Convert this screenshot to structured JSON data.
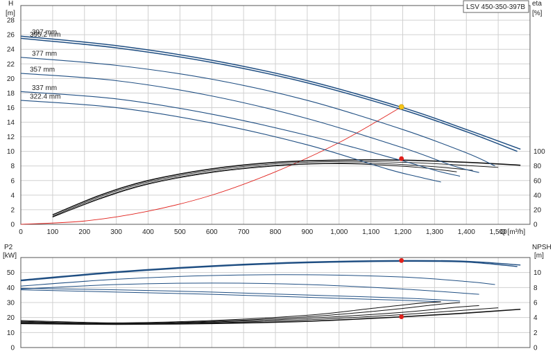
{
  "model_label": "LSV 450-350-397B",
  "colors": {
    "impeller": "#1f4e82",
    "efficiency": "#111111",
    "system": "#e0201b",
    "duty_point": "#e0201b",
    "duty_highlight": "#f5c518",
    "grid": "#d0d0d0",
    "axis": "#555555"
  },
  "chart_data": [
    {
      "type": "line",
      "panel": "head-efficiency",
      "y_axis_left": {
        "title": "H",
        "unit": "[m]",
        "range": [
          0,
          30
        ],
        "ticks": [
          0,
          2,
          4,
          6,
          8,
          10,
          12,
          14,
          16,
          18,
          20,
          22,
          24,
          26,
          28
        ]
      },
      "y_axis_right": {
        "title": "eta",
        "unit": "[%]",
        "range": [
          0,
          300
        ],
        "ticks": [
          0,
          20,
          40,
          60,
          80,
          100
        ]
      },
      "x_axis": {
        "title": "Q [m³/h]",
        "range": [
          0,
          1600
        ],
        "ticks": [
          0,
          100,
          200,
          300,
          400,
          500,
          600,
          700,
          800,
          900,
          1000,
          1100,
          1200,
          1300,
          1400,
          1500
        ],
        "tick_labels": [
          "0",
          "100",
          "200",
          "300",
          "400",
          "500",
          "600",
          "700",
          "800",
          "900",
          "1,000",
          "1,100",
          "1,200",
          "1,300",
          "1,400",
          "1,500"
        ]
      },
      "grid": true,
      "series": [
        {
          "name": "397 mm",
          "q": [
            0,
            300,
            600,
            900,
            1200,
            1400,
            1570
          ],
          "h": [
            25.8,
            24.5,
            22.5,
            19.7,
            16.0,
            13.0,
            10.3
          ]
        },
        {
          "name": "395.2 mm",
          "q": [
            0,
            300,
            600,
            900,
            1200,
            1400,
            1560
          ],
          "h": [
            25.5,
            24.2,
            22.2,
            19.4,
            15.7,
            12.7,
            10.0
          ]
        },
        {
          "name": "377 mm",
          "q": [
            0,
            300,
            600,
            900,
            1200,
            1400,
            1490
          ],
          "h": [
            22.9,
            21.8,
            19.9,
            17.0,
            13.0,
            9.8,
            8.0
          ]
        },
        {
          "name": "357 mm",
          "q": [
            0,
            300,
            600,
            900,
            1200,
            1360,
            1440
          ],
          "h": [
            20.7,
            19.7,
            17.6,
            14.5,
            10.5,
            8.0,
            7.1
          ]
        },
        {
          "name": "337 mm",
          "q": [
            0,
            300,
            600,
            900,
            1200,
            1310,
            1380
          ],
          "h": [
            18.2,
            17.2,
            15.1,
            12.2,
            8.7,
            7.3,
            6.6
          ]
        },
        {
          "name": "322.4 mm",
          "q": [
            0,
            300,
            600,
            900,
            1150,
            1240,
            1320
          ],
          "h": [
            17.0,
            16.0,
            13.9,
            10.9,
            7.6,
            6.6,
            5.8
          ]
        }
      ],
      "efficiency_series": [
        {
          "q": [
            100,
            250,
            400,
            600,
            800,
            1000,
            1200,
            1400,
            1570
          ],
          "eta": [
            13,
            40,
            60,
            76,
            85,
            88,
            88,
            85,
            81
          ]
        },
        {
          "q": [
            100,
            250,
            400,
            600,
            800,
            1000,
            1200,
            1350,
            1500
          ],
          "eta": [
            11,
            38,
            58,
            74,
            83,
            86,
            85,
            82,
            78
          ]
        },
        {
          "q": [
            100,
            250,
            400,
            600,
            800,
            1000,
            1150,
            1300,
            1420
          ],
          "eta": [
            10,
            36,
            56,
            72,
            81,
            84,
            83,
            79,
            74
          ]
        },
        {
          "q": [
            100,
            250,
            400,
            600,
            800,
            950,
            1100,
            1250,
            1370
          ],
          "eta": [
            10,
            35,
            55,
            71,
            80,
            83,
            82,
            78,
            72
          ]
        }
      ],
      "system_curve": {
        "q": [
          0,
          200,
          400,
          600,
          800,
          1000,
          1196
        ],
        "h": [
          0,
          0.45,
          1.8,
          4.0,
          7.2,
          11.2,
          16.1
        ]
      },
      "duty_points": [
        {
          "q": 1196,
          "h": 16.1,
          "highlight": true
        },
        {
          "q": 1196,
          "eta": 90
        }
      ]
    },
    {
      "type": "line",
      "panel": "power-npsh",
      "y_axis_left": {
        "title": "P2",
        "unit": "[kW]",
        "range": [
          0,
          60
        ],
        "ticks": [
          0,
          10,
          20,
          30,
          40,
          50
        ]
      },
      "y_axis_right": {
        "title": "NPSH",
        "unit": "[m]",
        "range": [
          0,
          12
        ],
        "ticks": [
          0,
          2,
          4,
          6,
          8,
          10
        ]
      },
      "x_axis": {
        "range": [
          0,
          1600
        ]
      },
      "grid": true,
      "power_series": [
        {
          "q": [
            0,
            300,
            600,
            900,
            1200,
            1400,
            1570
          ],
          "p2": [
            45.0,
            50.5,
            54.5,
            57.0,
            58.0,
            57.5,
            55.0
          ]
        },
        {
          "q": [
            0,
            300,
            600,
            900,
            1200,
            1400,
            1560
          ],
          "p2": [
            44.5,
            50.0,
            54.0,
            56.5,
            57.5,
            57.0,
            54.0
          ]
        },
        {
          "q": [
            0,
            300,
            600,
            900,
            1200,
            1400,
            1490
          ],
          "p2": [
            41.0,
            45.5,
            48.0,
            48.5,
            47.0,
            44.0,
            42.0
          ]
        },
        {
          "q": [
            0,
            300,
            600,
            900,
            1200,
            1440
          ],
          "p2": [
            39.0,
            42.0,
            43.0,
            42.0,
            39.0,
            35.5
          ]
        },
        {
          "q": [
            0,
            300,
            600,
            900,
            1200,
            1380
          ],
          "p2": [
            39.5,
            38.5,
            37.0,
            35.0,
            33.0,
            31.0
          ]
        },
        {
          "q": [
            0,
            300,
            600,
            900,
            1200,
            1320
          ],
          "p2": [
            38.5,
            37.0,
            35.5,
            33.5,
            31.5,
            30.5
          ]
        }
      ],
      "npsh_series": [
        {
          "q": [
            0,
            300,
            600,
            900,
            1200,
            1400,
            1570
          ],
          "npsh": [
            3.2,
            3.1,
            3.2,
            3.5,
            4.1,
            4.6,
            5.1
          ]
        },
        {
          "q": [
            0,
            300,
            600,
            900,
            1200,
            1400,
            1500
          ],
          "npsh": [
            3.3,
            3.1,
            3.3,
            3.7,
            4.4,
            5.0,
            5.3
          ]
        },
        {
          "q": [
            0,
            300,
            600,
            900,
            1200,
            1350,
            1440
          ],
          "npsh": [
            3.4,
            3.2,
            3.4,
            3.9,
            4.7,
            5.3,
            5.6
          ]
        },
        {
          "q": [
            0,
            300,
            600,
            900,
            1150,
            1300,
            1380
          ],
          "npsh": [
            3.5,
            3.2,
            3.5,
            4.1,
            5.0,
            5.7,
            6.0
          ]
        },
        {
          "q": [
            0,
            300,
            600,
            900,
            1100,
            1250,
            1320
          ],
          "npsh": [
            3.6,
            3.3,
            3.6,
            4.3,
            5.2,
            5.9,
            6.1
          ]
        }
      ],
      "duty_points": [
        {
          "q": 1196,
          "p2": 58.0
        },
        {
          "q": 1196,
          "npsh": 4.1
        }
      ]
    }
  ]
}
